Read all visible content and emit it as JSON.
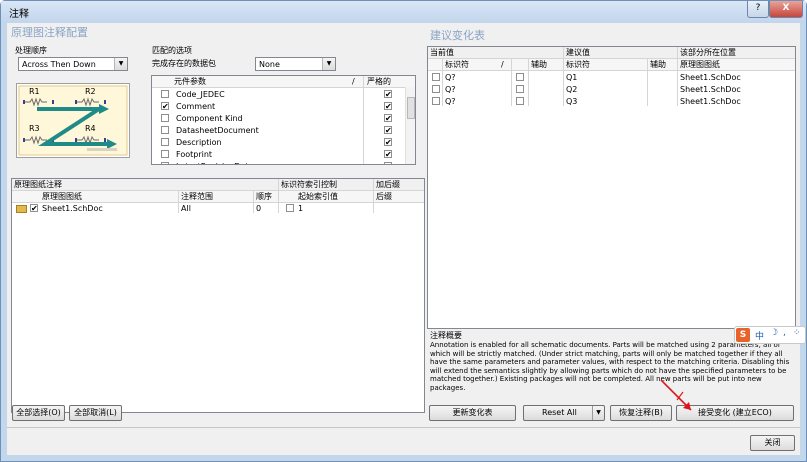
{
  "window": {
    "title": "注释",
    "help_label": "?",
    "close_label": "X"
  },
  "left": {
    "header": "原理图注释配置",
    "order": {
      "label": "处理顺序",
      "value": "Across Then Down"
    },
    "diagram_labels": [
      "R1",
      "R2",
      "R3",
      "R4"
    ],
    "match": {
      "label": "匹配的选项",
      "complete_label": "完成存在的数据包",
      "complete_value": "None",
      "columns": [
        "元件参数",
        "/",
        "严格的"
      ],
      "rows": [
        {
          "name": "Code_JEDEC",
          "checked": false,
          "strict": true
        },
        {
          "name": "Comment",
          "checked": true,
          "strict": true
        },
        {
          "name": "Component Kind",
          "checked": false,
          "strict": true
        },
        {
          "name": "DatasheetDocument",
          "checked": false,
          "strict": true
        },
        {
          "name": "Description",
          "checked": false,
          "strict": true
        },
        {
          "name": "Footprint",
          "checked": false,
          "strict": true
        },
        {
          "name": "LatestRevisionDate",
          "checked": false,
          "strict": true
        }
      ]
    },
    "sheets": {
      "group_labels": [
        "原理图纸注释",
        "标识符索引控制",
        "加后缀"
      ],
      "columns": [
        "原理图图纸",
        "注释范围",
        "顺序",
        "起始索引值",
        "后缀"
      ],
      "rows": [
        {
          "sheet": "Sheet1.SchDoc",
          "scope": "All",
          "order": "0",
          "start": "1",
          "suffix": ""
        }
      ]
    },
    "buttons": {
      "select_all": "全部选择(O)",
      "cancel_all": "全部取消(L)"
    }
  },
  "right": {
    "header": "建议变化表",
    "groups": [
      "当前值",
      "建议值",
      "该部分所在位置"
    ],
    "columns": [
      "标识符",
      "/",
      "辅助",
      "标识符",
      "辅助",
      "原理图图纸"
    ],
    "rows": [
      {
        "current": "Q?",
        "proposed": "Q1",
        "sheet": "Sheet1.SchDoc"
      },
      {
        "current": "Q?",
        "proposed": "Q2",
        "sheet": "Sheet1.SchDoc"
      },
      {
        "current": "Q?",
        "proposed": "Q3",
        "sheet": "Sheet1.SchDoc"
      }
    ],
    "summary_title": "注释概要",
    "summary_text": "Annotation is enabled for all schematic documents. Parts will be matched using 2 parameters, all of which will be strictly matched. (Under strict matching, parts will only be matched together if they all have the same parameters and parameter values, with respect to the matching criteria. Disabling this will extend the semantics slightly by allowing parts which do not have the specified parameters to be matched together.) Existing packages will not be completed. All new parts will be put into new packages.",
    "buttons": {
      "update": "更新变化表",
      "reset": "Reset All",
      "restore": "恢复注释(B)",
      "accept": "接受变化 (建立ECO)"
    }
  },
  "ime": {
    "logo": "S",
    "lang": "中"
  },
  "footer": {
    "close": "关闭"
  },
  "colors": {
    "accent_arrow": "#1f8a87",
    "annotation_arrow": "#e0141c",
    "header_text": "#8aa3c6"
  }
}
